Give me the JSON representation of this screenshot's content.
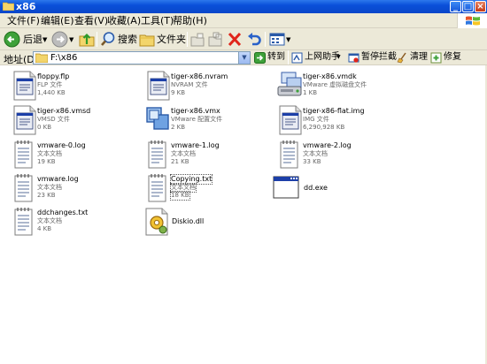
{
  "window": {
    "title": "x86"
  },
  "menu": [
    "文件(F)",
    "编辑(E)",
    "查看(V)",
    "收藏(A)",
    "工具(T)",
    "帮助(H)"
  ],
  "toolbar": {
    "back": "后退",
    "search": "搜索",
    "folders": "文件夹"
  },
  "address": {
    "label": "地址(D)",
    "value": "F:\\x86",
    "go": "转到",
    "online_help": "上网助手",
    "block_popups": "暂停拦截",
    "clean": "清理",
    "repair": "修复"
  },
  "files": [
    {
      "name": "floppy.flp",
      "type": "FLP 文件",
      "size": "1,440 KB",
      "icon": "generic-file-icon"
    },
    {
      "name": "tiger-x86.nvram",
      "type": "NVRAM 文件",
      "size": "9 KB",
      "icon": "generic-file-icon"
    },
    {
      "name": "tiger-x86.vmdk",
      "type": "VMware 虚拟磁盘文件",
      "size": "1 KB",
      "icon": "vmware-disk-icon"
    },
    {
      "name": "tiger-x86.vmsd",
      "type": "VMSD 文件",
      "size": "0 KB",
      "icon": "generic-file-icon"
    },
    {
      "name": "tiger-x86.vmx",
      "type": "VMware 配置文件",
      "size": "2 KB",
      "icon": "vmware-config-icon"
    },
    {
      "name": "tiger-x86-flat.img",
      "type": "IMG 文件",
      "size": "6,290,928 KB",
      "icon": "generic-file-icon"
    },
    {
      "name": "vmware-0.log",
      "type": "文本文档",
      "size": "19 KB",
      "icon": "text-document-icon"
    },
    {
      "name": "vmware-1.log",
      "type": "文本文档",
      "size": "21 KB",
      "icon": "text-document-icon"
    },
    {
      "name": "vmware-2.log",
      "type": "文本文档",
      "size": "33 KB",
      "icon": "text-document-icon"
    },
    {
      "name": "vmware.log",
      "type": "文本文档",
      "size": "23 KB",
      "icon": "text-document-icon"
    },
    {
      "name": "Copying.txt",
      "type": "文本文档",
      "size": "18 KB",
      "icon": "text-document-icon"
    },
    {
      "name": "dd.exe",
      "type": "",
      "size": "",
      "icon": "executable-icon"
    },
    {
      "name": "ddchanges.txt",
      "type": "文本文档",
      "size": "4 KB",
      "icon": "text-document-icon"
    },
    {
      "name": "Diskio.dll",
      "type": "",
      "size": "",
      "icon": "dll-gear-icon"
    }
  ]
}
